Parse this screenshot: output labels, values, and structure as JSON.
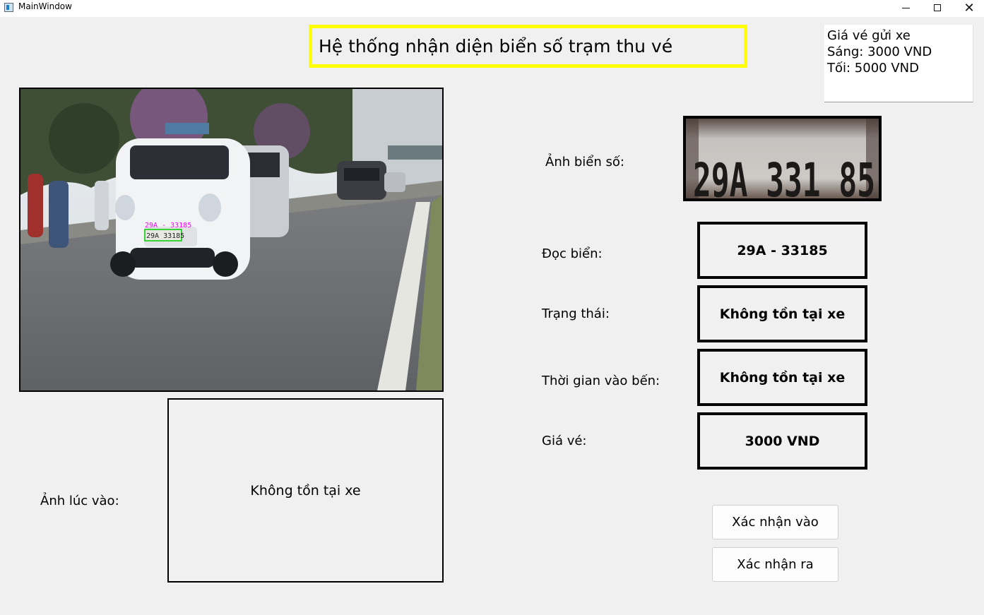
{
  "window": {
    "title": "MainWindow",
    "minimize_icon": "minimize-icon",
    "maximize_icon": "maximize-icon",
    "close_glyph": "✕"
  },
  "header": {
    "title": "Hệ thống nhận diện biển số trạm thu vé"
  },
  "price_panel": {
    "line1": "Giá vé gửi xe",
    "line2": "Sáng: 3000 VND",
    "line3": "Tối: 5000 VND"
  },
  "camera": {
    "overlay_text": "29A - 33185",
    "plate_text": "29A 33185",
    "detection_color": "#00cc00",
    "overlay_color": "#ff00ff"
  },
  "plate_image": {
    "label": "Ảnh biển số:",
    "plate_text": "29A 331 85"
  },
  "read_plate": {
    "label": "Đọc biển:",
    "value": "29A - 33185"
  },
  "status": {
    "label": "Trạng thái:",
    "value": "Không tồn tại xe"
  },
  "entry_time": {
    "label": "Thời gian vào bến:",
    "value": "Không tồn tại xe"
  },
  "ticket_price": {
    "label": "Giá vé:",
    "value": "3000 VND"
  },
  "entry_image": {
    "label": "Ảnh lúc vào:",
    "value": "Không tồn tại xe"
  },
  "buttons": {
    "confirm_in": "Xác nhận vào",
    "confirm_out": "Xác nhận ra"
  },
  "colors": {
    "title_border": "#ffff00",
    "background": "#f0f0f0"
  }
}
